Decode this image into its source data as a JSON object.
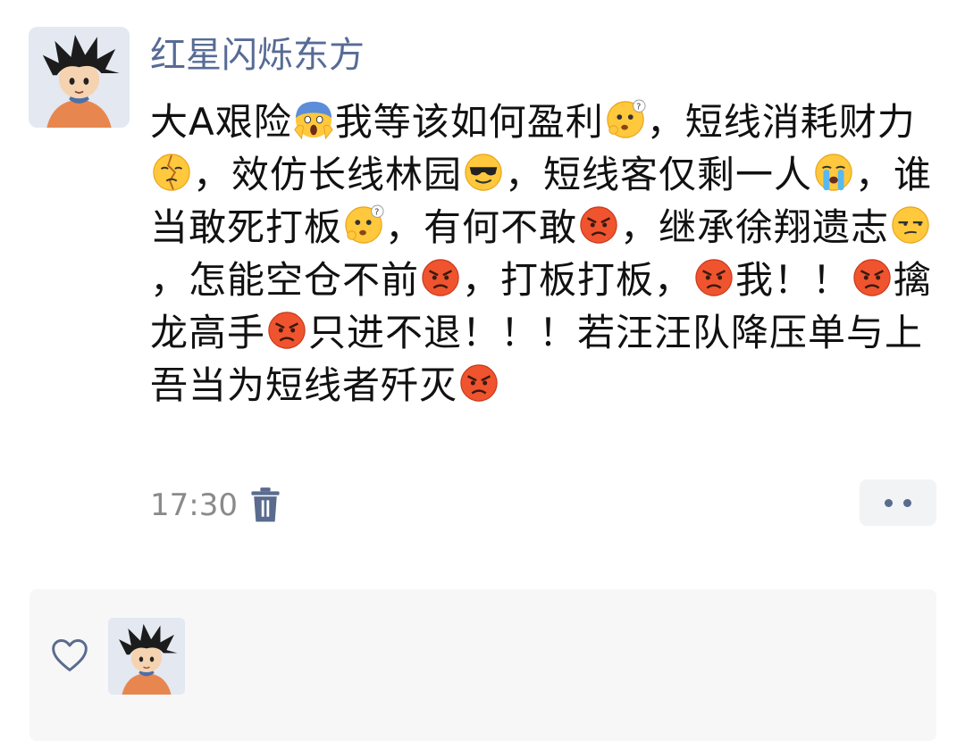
{
  "post": {
    "username": "红星闪烁东方",
    "segments": [
      {
        "t": "大A艰险"
      },
      {
        "e": "scream-emoji"
      },
      {
        "t": "我等该如何盈利"
      },
      {
        "e": "thinking-emoji"
      },
      {
        "t": "，短线消耗财力"
      },
      {
        "e": "heartbroken-emoji"
      },
      {
        "t": "，效仿长线林园"
      },
      {
        "e": "sunglasses-emoji"
      },
      {
        "t": "，短线客仅剩一人"
      },
      {
        "e": "crying-emoji"
      },
      {
        "t": "，谁当敢死打板"
      },
      {
        "e": "thinking-emoji"
      },
      {
        "t": "，有何不敢"
      },
      {
        "e": "angry-emoji"
      },
      {
        "t": "，继承徐翔遗志"
      },
      {
        "e": "unamused-emoji"
      },
      {
        "t": "，怎能空仓不前"
      },
      {
        "e": "angry-emoji"
      },
      {
        "t": "，打板打板，"
      },
      {
        "e": "angry-emoji"
      },
      {
        "t": "我！！"
      },
      {
        "e": "angry-emoji"
      },
      {
        "t": "擒龙高手"
      },
      {
        "e": "angry-emoji"
      },
      {
        "t": "只进不退！！！若汪汪队降压单与上吾当为短线者歼灭"
      },
      {
        "e": "angry-emoji"
      }
    ],
    "time": "17:30"
  }
}
